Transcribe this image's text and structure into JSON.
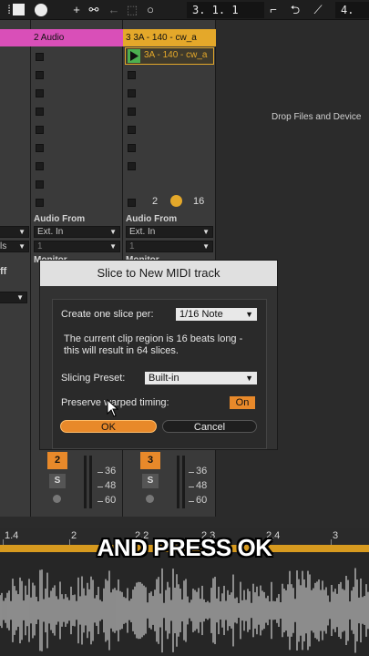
{
  "toolbar": {
    "position": "3.  1.  1",
    "right_readout": "4."
  },
  "session": {
    "drop_hint": "Drop Files and Device",
    "tracks": [
      {
        "name": "",
        "color": "#d94fb8"
      },
      {
        "name": "2 Audio",
        "color": "#d94fb8"
      },
      {
        "name": "3 3A - 140 - cw_a",
        "color": "#e4a82a"
      }
    ],
    "clip_name": "3A - 140 - cw_a",
    "left_partial": {
      "ext_in_tail": "ls",
      "monitor_tail": "ff"
    },
    "io": [
      {
        "audio_from": "Audio From",
        "input": "Ext. In",
        "channel": "1",
        "monitor": "Monitor"
      },
      {
        "audio_from": "Audio From",
        "input": "Ext. In",
        "channel": "1",
        "monitor": "Monitor"
      }
    ],
    "clip_counter": {
      "number": "2",
      "count": "16"
    },
    "mixer": [
      {
        "track_number": "2",
        "solo": "S",
        "db": [
          "36",
          "48",
          "60"
        ]
      },
      {
        "track_number": "3",
        "solo": "S",
        "db": [
          "36",
          "48",
          "60"
        ]
      }
    ]
  },
  "dialog": {
    "title": "Slice to New MIDI track",
    "slice_label": "Create one slice per:",
    "slice_value": "1/16 Note",
    "info": "The current clip region is 16 beats long - this will result in 64 slices.",
    "preset_label": "Slicing Preset:",
    "preset_value": "Built-in",
    "preserve_label": "Preserve warped timing:",
    "preserve_value": "On",
    "ok_label": "OK",
    "cancel_label": "Cancel",
    "accent": "#e8892a"
  },
  "ruler": [
    "1.4",
    "2",
    "2.2",
    "2.3",
    "2.4",
    "3"
  ],
  "caption": "AND PRESS OK"
}
